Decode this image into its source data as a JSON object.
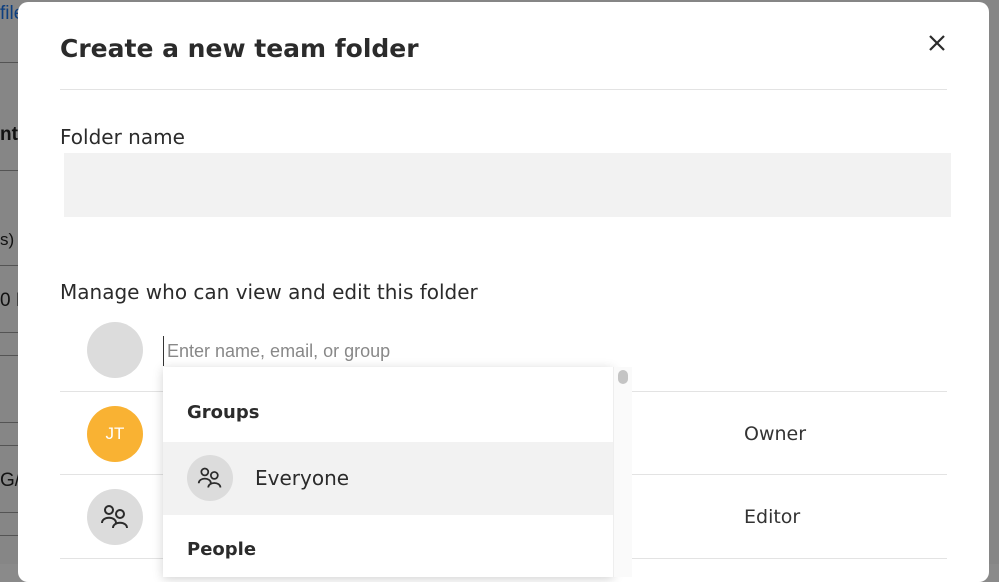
{
  "background": {
    "fragments": [
      "file",
      "nt",
      "s)",
      "0 H",
      "",
      "G/"
    ]
  },
  "modal": {
    "title": "Create a new team folder",
    "folder_name_label": "Folder name",
    "folder_name_value": "",
    "permissions_label": "Manage who can view and edit this folder",
    "share_input_placeholder": "Enter name, email, or group",
    "members": [
      {
        "avatar_type": "initials",
        "initials": "JT",
        "avatar_color": "#f9b233",
        "role": "Owner"
      },
      {
        "avatar_type": "group-icon",
        "role": "Editor"
      }
    ],
    "dropdown": {
      "groups_heading": "Groups",
      "groups": [
        {
          "label": "Everyone",
          "icon": "group-icon"
        }
      ],
      "people_heading": "People"
    }
  },
  "colors": {
    "accent_orange": "#f9b233",
    "link_blue": "#1a73e8",
    "input_bg": "#f2f2f2"
  }
}
